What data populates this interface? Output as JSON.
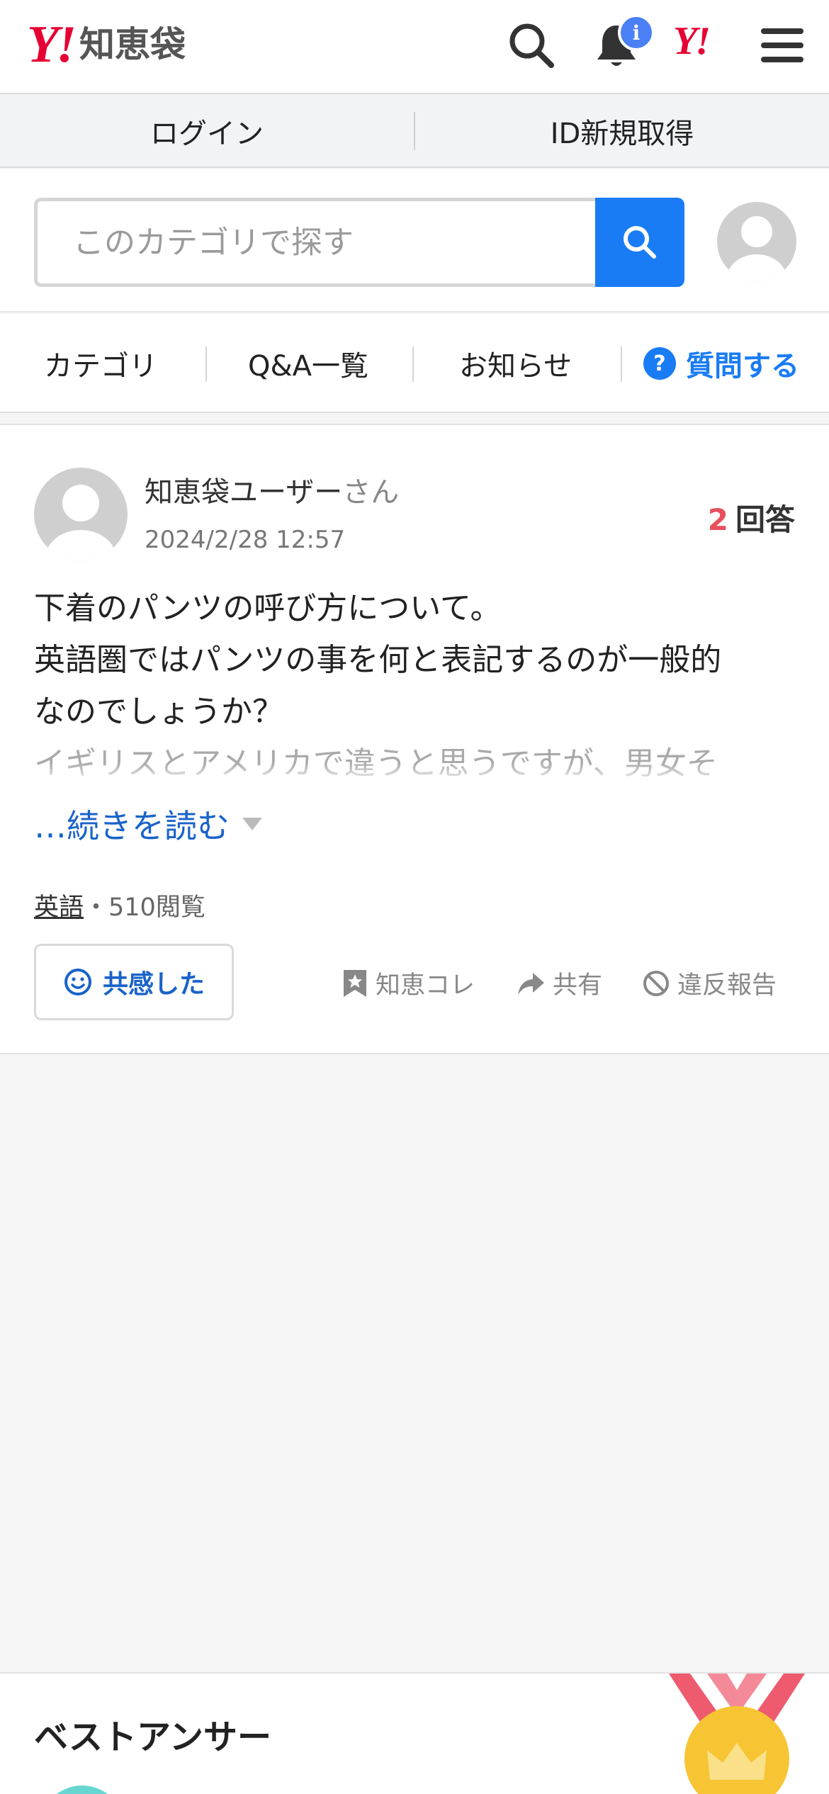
{
  "header": {
    "logo_mark": "Y!",
    "logo_text": "知恵袋",
    "notification_badge": "i",
    "yj_mark": "Y!"
  },
  "login_bar": {
    "login": "ログイン",
    "register": "ID新規取得"
  },
  "search": {
    "placeholder": "このカテゴリで探す"
  },
  "nav": {
    "category": "カテゴリ",
    "qa_list": "Q&A一覧",
    "news": "お知らせ",
    "ask_icon": "?",
    "ask": "質問する"
  },
  "question": {
    "user_name": "知恵袋ユーザー",
    "user_suffix": "さん",
    "date": "2024/2/28 12:57",
    "answer_count": "2",
    "answer_label": "回答",
    "body_line1": "下着のパンツの呼び方について。",
    "body_line2": "英語圏ではパンツの事を何と表記するのが一般的",
    "body_line3": "なのでしょうか？",
    "body_faded": "イギリスとアメリカで違うと思うですが、男女そ",
    "read_more": "…続きを読む",
    "category": "英語",
    "views": "・510閲覧",
    "empathy_label": "共感した",
    "save_label": "知恵コレ",
    "share_label": "共有",
    "report_label": "違反報告"
  },
  "best_answer": {
    "title": "ベストアンサー"
  },
  "colors": {
    "brand_red": "#e60033",
    "accent_blue": "#1a7cf5",
    "link_blue": "#1a63c9",
    "answer_count_red": "#e8505b"
  },
  "icons": [
    "search-icon",
    "bell-icon",
    "menu-icon",
    "user-avatar-icon",
    "question-circle-icon",
    "smile-icon",
    "bookmark-star-icon",
    "share-arrow-icon",
    "prohibit-icon",
    "crown-medal-icon"
  ]
}
